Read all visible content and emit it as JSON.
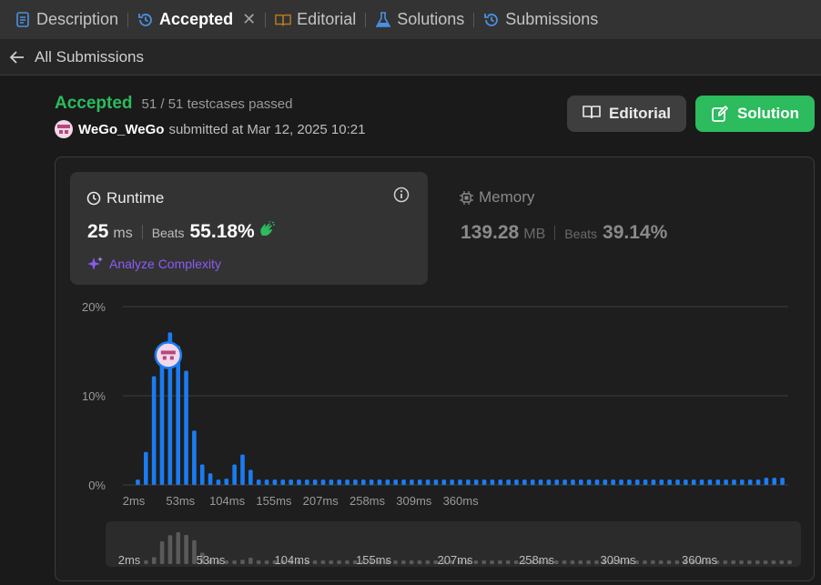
{
  "tabs": [
    {
      "label": "Description",
      "icon": "document-icon",
      "color": "#4a90e2"
    },
    {
      "label": "Accepted",
      "icon": "history-icon",
      "color": "#4a90e2",
      "active": true
    },
    {
      "label": "Editorial",
      "icon": "book-icon",
      "color": "#b7791f"
    },
    {
      "label": "Solutions",
      "icon": "flask-icon",
      "color": "#4a90e2"
    },
    {
      "label": "Submissions",
      "icon": "history-icon",
      "color": "#4a90e2"
    }
  ],
  "back": {
    "label": "All Submissions"
  },
  "status": {
    "label": "Accepted",
    "testcases": "51 / 51 testcases passed"
  },
  "submitter": {
    "username": "WeGo_WeGo",
    "text": "submitted at Mar 12, 2025 10:21"
  },
  "buttons": {
    "editorial": "Editorial",
    "solution": "Solution"
  },
  "runtime": {
    "title": "Runtime",
    "value": "25",
    "unit": "ms",
    "beats_label": "Beats",
    "beats_value": "55.18%",
    "analyze": "Analyze Complexity"
  },
  "memory": {
    "title": "Memory",
    "value": "139.28",
    "unit": "MB",
    "beats_label": "Beats",
    "beats_value": "39.14%"
  },
  "colors": {
    "accent_green": "#2cbb5d",
    "bar_blue": "#1a7cf2",
    "analyze_purple": "#8b5cf6"
  },
  "chart_data": {
    "type": "bar",
    "title": "",
    "xlabel": "",
    "ylabel": "",
    "ylim": [
      0,
      20
    ],
    "y_ticks": [
      "20%",
      "10%",
      "0%"
    ],
    "x_ticks": [
      "2ms",
      "53ms",
      "104ms",
      "155ms",
      "207ms",
      "258ms",
      "309ms",
      "360ms"
    ],
    "highlight_index": 4,
    "values": [
      0.6,
      3.7,
      12.2,
      15.5,
      17.1,
      15.6,
      12.8,
      6.1,
      2.3,
      1.3,
      0.6,
      0.7,
      2.3,
      3.4,
      1.7,
      0.6,
      0.6,
      0.6,
      0.6,
      0.6,
      0.6,
      0.6,
      0.6,
      0.6,
      0.6,
      0.6,
      0.6,
      0.6,
      0.6,
      0.6,
      0.6,
      0.6,
      0.6,
      0.6,
      0.6,
      0.6,
      0.6,
      0.6,
      0.6,
      0.6,
      0.6,
      0.6,
      0.6,
      0.6,
      0.6,
      0.6,
      0.6,
      0.6,
      0.6,
      0.6,
      0.6,
      0.6,
      0.6,
      0.6,
      0.6,
      0.6,
      0.6,
      0.6,
      0.6,
      0.6,
      0.6,
      0.6,
      0.6,
      0.6,
      0.6,
      0.6,
      0.6,
      0.6,
      0.6,
      0.6,
      0.6,
      0.6,
      0.6,
      0.6,
      0.6,
      0.6,
      0.6,
      0.6,
      0.8,
      0.8,
      0.8
    ]
  },
  "mini_chart": {
    "x_ticks": [
      "2ms",
      "53ms",
      "104ms",
      "155ms",
      "207ms",
      "258ms",
      "309ms",
      "360ms"
    ]
  }
}
